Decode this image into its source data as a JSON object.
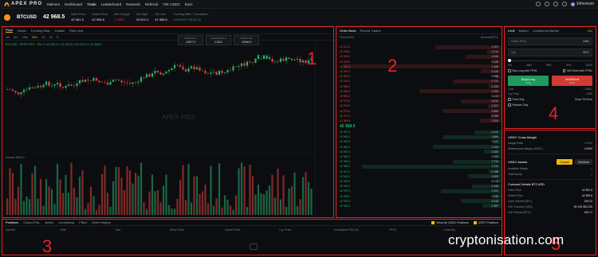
{
  "nav": {
    "logo": "APEX PRO",
    "items": [
      "Mainnet",
      "Dashboard",
      "Trade",
      "Leaderboard",
      "Rewards",
      "Referral",
      "72K USDC",
      "Earn"
    ],
    "wallet": "Ethereum"
  },
  "ticker": {
    "symbol": "BTCUSD",
    "price": "42 968.5",
    "stats": [
      {
        "k": "Index Price",
        "v": "42 981.5",
        "tone": "neutral"
      },
      {
        "k": "Oracle Price",
        "v": "42 955.8",
        "tone": "neutral"
      },
      {
        "k": "24h Change",
        "v": "-1.95%",
        "tone": "red"
      },
      {
        "k": "24h High",
        "v": "43 622.0",
        "tone": "neutral"
      },
      {
        "k": "24h Low",
        "v": "41 988.5",
        "tone": "neutral"
      },
      {
        "k": "Funding Rate / Countdown",
        "v": "0.0013% / 00:51:12",
        "tone": "green"
      }
    ]
  },
  "chart": {
    "tabs": [
      "Price",
      "Depth",
      "Funding Rate",
      "Details",
      "Risk Limit"
    ],
    "timeframes": [
      "1m",
      "5m",
      "15m",
      "30m",
      "1h",
      "4h",
      "D"
    ],
    "legend": "BTCUSD · APEX PRO · 30m  O 42 930.0  H 42 990.5  L 42 910.0  C 42 968.5",
    "boxes": [
      {
        "k": "Market Buy",
        "v": "42967.5"
      },
      {
        "k": "Quantity(BTC)",
        "v": "0.0001"
      },
      {
        "k": "Market Sell",
        "v": "42968.5"
      }
    ],
    "volume_label": "Volume SMA 9",
    "watermark": "APEX PRO",
    "label": "1"
  },
  "orderbook": {
    "tabs": [
      "Order Book",
      "Recent Trades"
    ],
    "head_price": "Price(USD)",
    "head_amount": "Amount(BTC)",
    "label": "2",
    "asks": [
      [
        "43 011.0",
        "1.001"
      ],
      [
        "43 008.5",
        "0.214"
      ],
      [
        "43 005.0",
        "0.540"
      ],
      [
        "43 002.5",
        "0.128"
      ],
      [
        "43 000.0",
        "2.406"
      ],
      [
        "42 997.5",
        "0.315"
      ],
      [
        "42 994.0",
        "0.088"
      ],
      [
        "42 991.5",
        "0.731"
      ],
      [
        "42 988.0",
        "0.199"
      ],
      [
        "42 985.5",
        "1.250"
      ],
      [
        "42 982.0",
        "0.043"
      ],
      [
        "42 979.5",
        "0.612"
      ],
      [
        "42 976.0",
        "0.207"
      ],
      [
        "42 973.5",
        "0.890"
      ],
      [
        "42 971.0",
        "0.156"
      ],
      [
        "42 969.5",
        "0.324"
      ]
    ],
    "mid": "42 968.5",
    "bids": [
      [
        "42 967.5",
        "0.412"
      ],
      [
        "42 965.0",
        "0.880"
      ],
      [
        "42 962.5",
        "0.117"
      ],
      [
        "42 960.0",
        "1.043"
      ],
      [
        "42 957.5",
        "0.265"
      ],
      [
        "42 955.0",
        "0.091"
      ],
      [
        "42 952.5",
        "0.734"
      ],
      [
        "42 950.0",
        "2.110"
      ],
      [
        "42 947.5",
        "0.188"
      ],
      [
        "42 945.0",
        "0.509"
      ],
      [
        "42 942.5",
        "0.073"
      ],
      [
        "42 940.0",
        "0.446"
      ],
      [
        "42 937.5",
        "0.921"
      ],
      [
        "42 935.0",
        "0.132"
      ],
      [
        "42 932.5",
        "0.618"
      ],
      [
        "42 930.0",
        "0.287"
      ]
    ]
  },
  "positions": {
    "tabs": [
      "Positions",
      "Closed P&L",
      "Active",
      "Conditional",
      "Filled",
      "Order History"
    ],
    "checks": [
      "Show All USDC Positions",
      "USDT Positions"
    ],
    "columns": [
      "Symbol",
      "Side",
      "Size",
      "Entry Price",
      "Oracle Price",
      "Liq. Price",
      "Unrealized P&L(%)",
      "TP/SL",
      "Close By"
    ],
    "label": "3"
  },
  "order_form": {
    "tabs": [
      "Limit",
      "Market",
      "Conditional Market"
    ],
    "leverage": "10x",
    "price_placeholder": "Order Price",
    "price_unit": "USD",
    "qty_placeholder": "Qty",
    "qty_unit": "BTC",
    "percentages": [
      "0%",
      "25%",
      "50%",
      "75%",
      "100%"
    ],
    "options": [
      "Buy Long with TP/SL",
      "Sell Short with TP/SL"
    ],
    "buy_label": "Buy/Long",
    "buy_sub": "Cost",
    "sell_label": "Sell/Short",
    "sell_sub": "Cost",
    "kv": [
      {
        "k": "Cost",
        "v": "-- USDC"
      },
      {
        "k": "Liq. Price",
        "v": "-- USD"
      }
    ],
    "post_only": "Post-Only",
    "reduce_only": "Reduce-Only",
    "tif": "Good-Till-Time",
    "label": "4"
  },
  "account": {
    "margin_title": "USDC Cross Margin",
    "margin_kv": [
      {
        "k": "Margin Ratio",
        "v": "0.00%",
        "tone": "green"
      },
      {
        "k": "Maintenance Margin (USDC)",
        "v": "0.0000",
        "tone": "neutral"
      }
    ],
    "assets_title": "USDC Assets",
    "deposit": "Deposit",
    "withdraw": "Withdraw",
    "assets_kv": [
      {
        "k": "Available Margin",
        "v": "--"
      },
      {
        "k": "Total Equity",
        "v": "--"
      }
    ],
    "contract_title": "Contract Details BTCUSD",
    "contract_kv": [
      {
        "k": "Index Price",
        "v": "42 981.5"
      },
      {
        "k": "Oracle Price",
        "v": "42 955.8"
      },
      {
        "k": "Open Interest (BTC)",
        "v": "329.22"
      },
      {
        "k": "24H Turnover (USD)",
        "v": "18 249 460.225"
      },
      {
        "k": "24H Volume (BTC)",
        "v": "426.17"
      }
    ],
    "label": "5"
  },
  "watermark": "cryptonisation.com",
  "colors": {
    "up": "#26b36d",
    "down": "#e0453c",
    "accent": "#f0b90b",
    "annotation": "#e3242b"
  }
}
